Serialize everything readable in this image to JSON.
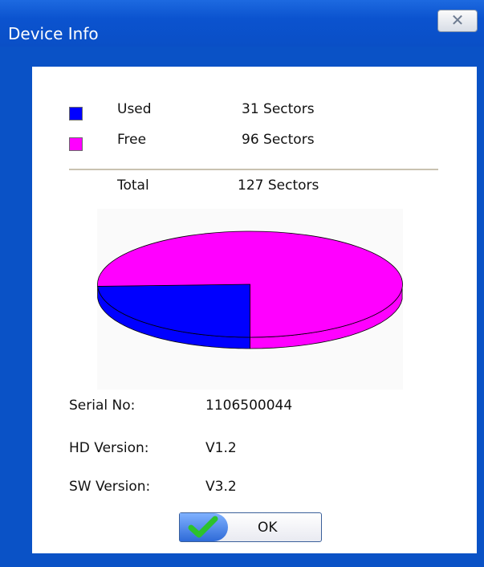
{
  "window": {
    "title": "Device Info",
    "close_glyph": "✕"
  },
  "legend": {
    "used": {
      "label": "Used",
      "value": "31 Sectors",
      "color": "#0000ff"
    },
    "free": {
      "label": "Free",
      "value": "96 Sectors",
      "color": "#ff00ff"
    },
    "total": {
      "label": "Total",
      "value": "127 Sectors"
    }
  },
  "chart_data": {
    "type": "pie",
    "categories": [
      "Used",
      "Free"
    ],
    "values": [
      31,
      96
    ],
    "colors": [
      "#0000ff",
      "#ff00ff"
    ]
  },
  "info": {
    "serial_label": "Serial No:",
    "serial_value": "1106500044",
    "hd_label": "HD Version:",
    "hd_value": "V1.2",
    "sw_label": "SW Version:",
    "sw_value": "V3.2"
  },
  "buttons": {
    "ok_label": "OK",
    "ok_icon": "check-icon"
  }
}
